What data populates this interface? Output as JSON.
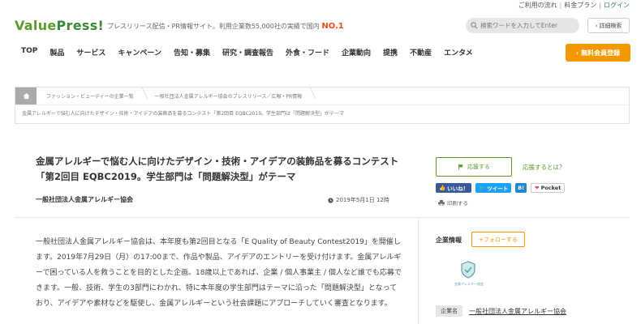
{
  "utility": {
    "flow": "ご利用の流れ",
    "price": "料金プラン",
    "login": "ログイン"
  },
  "header": {
    "logo_value": "Value",
    "logo_press": "Press!",
    "tagline": "プレスリリース配信・PR情報サイト。利用企業数55,000社の実績で国内",
    "tagline_no1": "NO.1",
    "search_placeholder": "検索ワードを入力してEnter",
    "advanced_search": "詳細検索"
  },
  "nav": {
    "items": [
      "TOP",
      "製品",
      "サービス",
      "キャンペーン",
      "告知・募集",
      "研究・調査報告",
      "外食・フード",
      "企業動向",
      "提携",
      "不動産",
      "エンタメ"
    ],
    "signup": "無料会員登録"
  },
  "breadcrumb": {
    "items": [
      "ファッション・ビューティーの企業一覧",
      "一般社団法人金属アレルギー協会のプレスリリース／広報・PR情報"
    ],
    "current": "金属アレルギーで悩む人に向けたデザイン・技術・アイデアの装飾品を募るコンテスト「第2回目 EQBC2019。学生部門は「問題解決型」がテーマ"
  },
  "article": {
    "title": "金属アレルギーで悩む人に向けたデザイン・技術・アイデアの装飾品を募るコンテスト「第2回目 EQBC2019。学生部門は「問題解決型」がテーマ",
    "org": "一般社団法人金属アレルギー協会",
    "date": "2019年5月1日 12時",
    "body": "一般社団法人金属アレルギー協会は、本年度も第2回目となる「E Quality of Beauty Contest2019」を開催します。2019年7月29日（月）の17:00まで、作品や製品、アイデアのエントリーを受け付けます。金属アレルギーで困っている人を救うことを目的とした企画。18歳以上であれば、企業 / 個人事業主 / 個人など誰でも応募できます。一般、技術、学生の3部門にわかれ、特に本年度の学生部門はテーマに沿った「問題解決型」となっており、アイデアや素材などを駆使し、金属アレルギーという社会課題にアプローチしていく審査となります。"
  },
  "side": {
    "cheer": "応援する",
    "cheer_what": "応援するとは？",
    "like": "いいね！",
    "tweet": "ツイート",
    "hatena": "B!",
    "pocket": "Pocket",
    "print": "印刷する",
    "corp_info": "企業情報",
    "follow": "+フォローする",
    "corp_logo_caption": "金属アレルギー協会",
    "corp_name_label": "企業名",
    "corp_name": "一般社団法人金属アレルギー協会"
  },
  "colors": {
    "brand_green": "#5c9a2c",
    "accent_orange": "#f39800",
    "twitter": "#1da1f2",
    "facebook": "#3b5998"
  }
}
